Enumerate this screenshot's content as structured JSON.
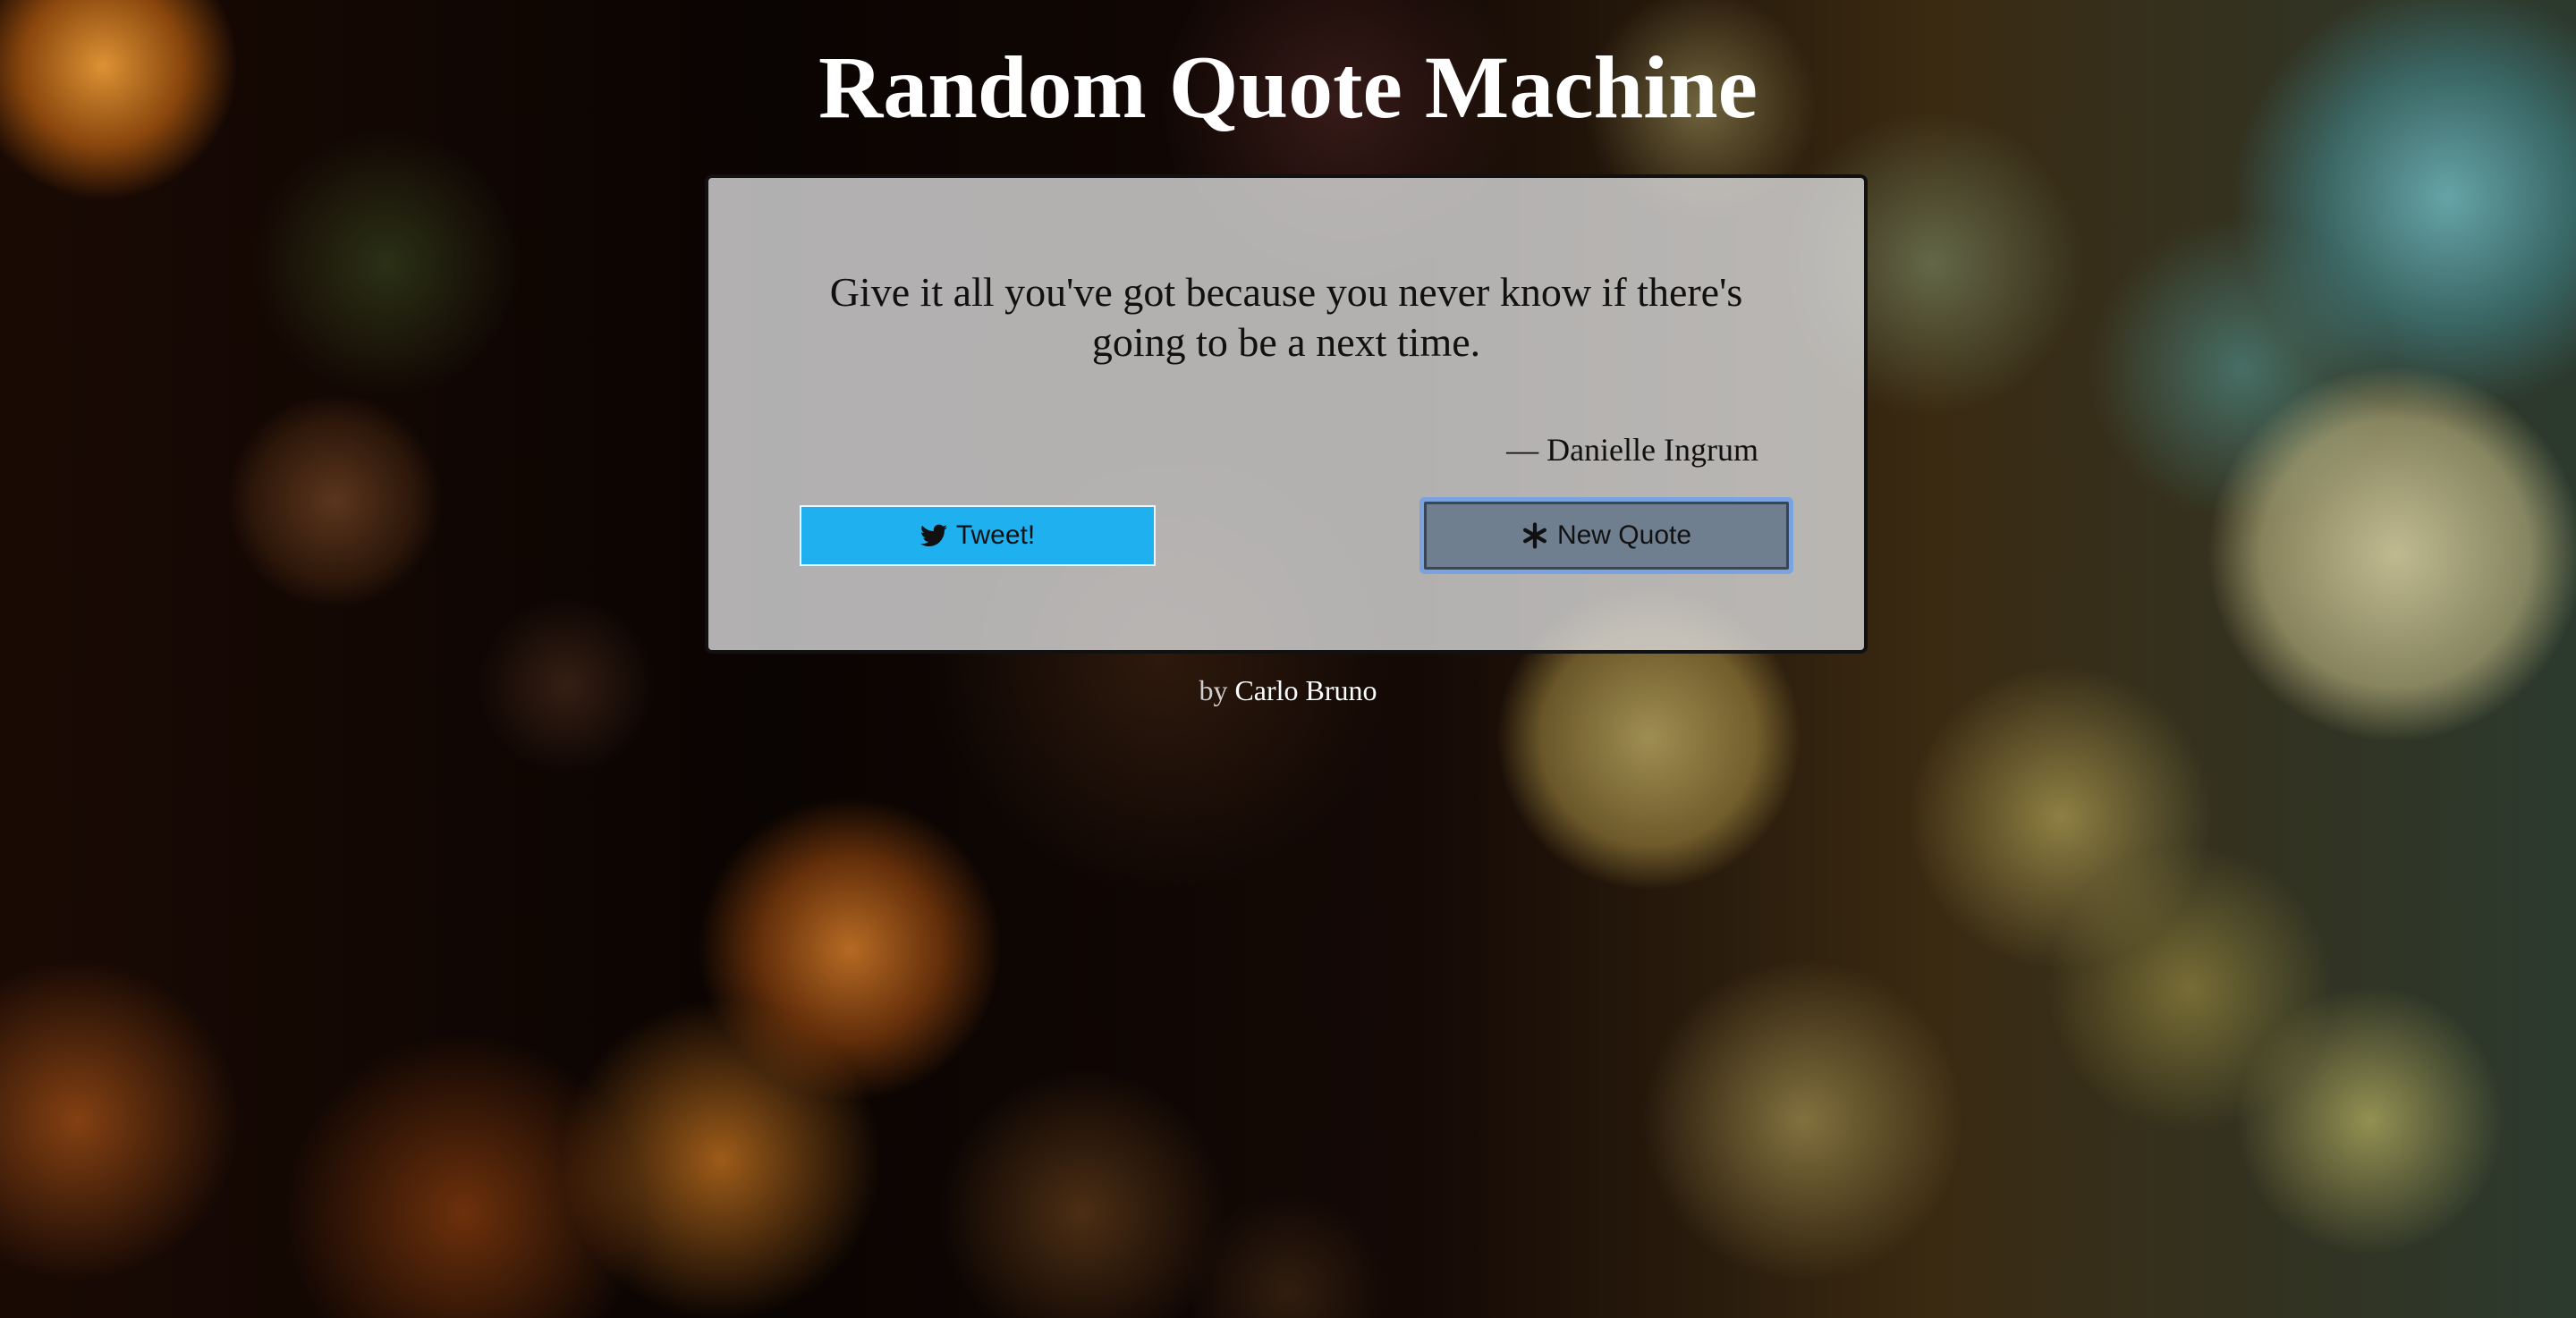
{
  "header": {
    "title": "Random Quote Machine"
  },
  "quote": {
    "text": "Give it all you've got because you never know if there's going to be a next time.",
    "author": "— Danielle Ingrum"
  },
  "buttons": {
    "tweet_label": "Tweet!",
    "tweet_icon": "twitter-bird-icon",
    "new_quote_label": "New Quote",
    "new_quote_icon": "asterisk-icon"
  },
  "footer": {
    "by_label": "by",
    "author_name": "Carlo Bruno"
  },
  "colors": {
    "tweet_button": "#1fb0ef",
    "new_quote_button": "#6f7f8f",
    "focus_ring": "#6ea0e6"
  }
}
